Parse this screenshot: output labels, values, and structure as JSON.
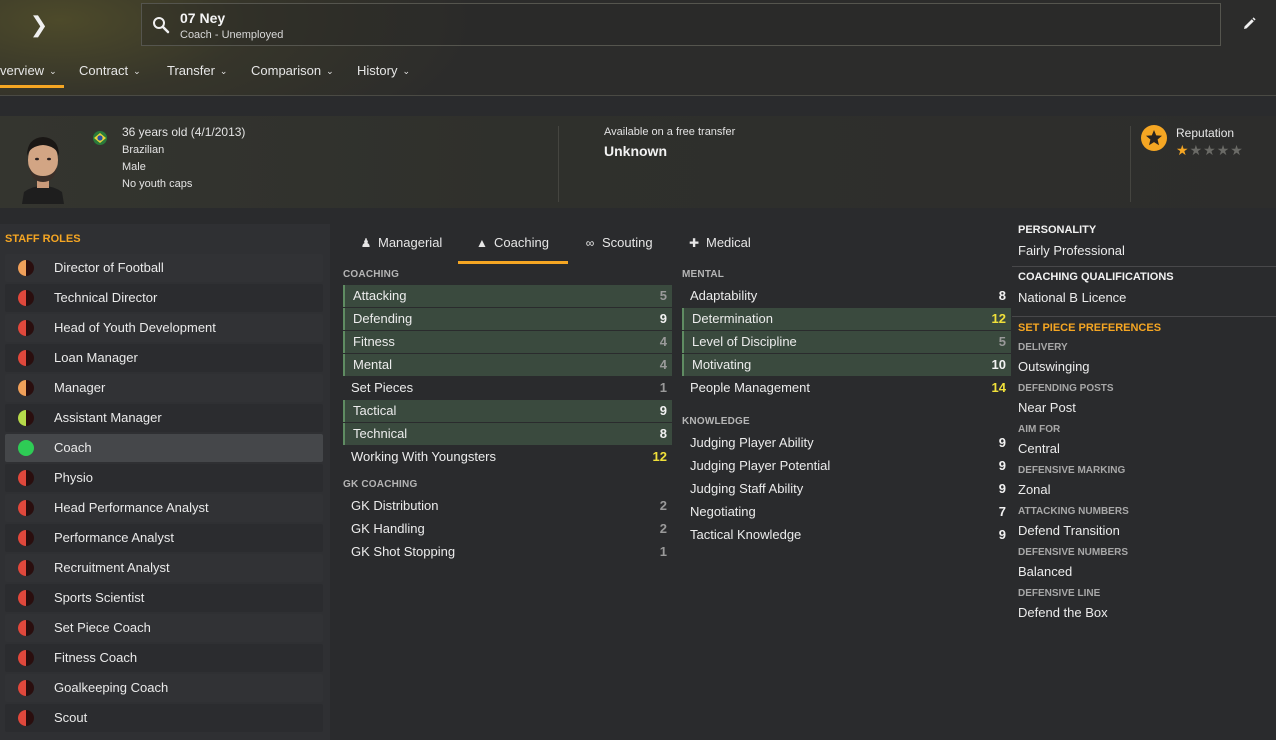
{
  "header": {
    "name": "07 Ney",
    "subtitle": "Coach - Unemployed"
  },
  "nav": [
    {
      "label": "verview",
      "active": true
    },
    {
      "label": "Contract"
    },
    {
      "label": "Transfer"
    },
    {
      "label": "Comparison"
    },
    {
      "label": "History"
    }
  ],
  "profile": {
    "age": "36 years old (4/1/2013)",
    "nationality": "Brazilian",
    "gender": "Male",
    "youth_caps": "No youth caps",
    "transfer_label": "Available on a free transfer",
    "transfer_value": "Unknown",
    "reputation_label": "Reputation",
    "reputation_stars": 1,
    "reputation_max": 5
  },
  "staff_roles": {
    "title": "STAFF ROLES",
    "items": [
      {
        "label": "Director of Football",
        "color": "#f0a05a"
      },
      {
        "label": "Technical Director",
        "color": "#e0483c"
      },
      {
        "label": "Head of Youth Development",
        "color": "#e0483c"
      },
      {
        "label": "Loan Manager",
        "color": "#e0483c"
      },
      {
        "label": "Manager",
        "color": "#f0a05a"
      },
      {
        "label": "Assistant Manager",
        "color": "#b6d94a"
      },
      {
        "label": "Coach",
        "color": "#2ecc55",
        "selected": true
      },
      {
        "label": "Physio",
        "color": "#e0483c"
      },
      {
        "label": "Head Performance Analyst",
        "color": "#e0483c"
      },
      {
        "label": "Performance Analyst",
        "color": "#e0483c"
      },
      {
        "label": "Recruitment Analyst",
        "color": "#e0483c"
      },
      {
        "label": "Sports Scientist",
        "color": "#e0483c"
      },
      {
        "label": "Set Piece Coach",
        "color": "#e0483c"
      },
      {
        "label": "Fitness Coach",
        "color": "#e0483c"
      },
      {
        "label": "Goalkeeping Coach",
        "color": "#e0483c"
      },
      {
        "label": "Scout",
        "color": "#e0483c"
      }
    ]
  },
  "tabs": [
    {
      "label": "Managerial",
      "icon": "managerial-icon"
    },
    {
      "label": "Coaching",
      "icon": "coaching-icon",
      "active": true
    },
    {
      "label": "Scouting",
      "icon": "binoculars-icon"
    },
    {
      "label": "Medical",
      "icon": "medical-kit-icon"
    }
  ],
  "coaching": {
    "title": "COACHING",
    "attrs": [
      {
        "name": "Attacking",
        "value": "5",
        "hl": true,
        "tone": "dim"
      },
      {
        "name": "Defending",
        "value": "9",
        "hl": true,
        "tone": "bright"
      },
      {
        "name": "Fitness",
        "value": "4",
        "hl": true,
        "tone": "dim"
      },
      {
        "name": "Mental",
        "value": "4",
        "hl": true,
        "tone": "dim"
      },
      {
        "name": "Set Pieces",
        "value": "1",
        "hl": false,
        "tone": "dim"
      },
      {
        "name": "Tactical",
        "value": "9",
        "hl": true,
        "tone": "bright"
      },
      {
        "name": "Technical",
        "value": "8",
        "hl": true,
        "tone": "bright"
      },
      {
        "name": "Working With Youngsters",
        "value": "12",
        "hl": false,
        "tone": "gold"
      }
    ]
  },
  "gk_coaching": {
    "title": "GK COACHING",
    "attrs": [
      {
        "name": "GK Distribution",
        "value": "2",
        "tone": "dim"
      },
      {
        "name": "GK Handling",
        "value": "2",
        "tone": "dim"
      },
      {
        "name": "GK Shot Stopping",
        "value": "1",
        "tone": "dim"
      }
    ]
  },
  "mental": {
    "title": "MENTAL",
    "attrs": [
      {
        "name": "Adaptability",
        "value": "8",
        "hl": false,
        "tone": "bright"
      },
      {
        "name": "Determination",
        "value": "12",
        "hl": true,
        "tone": "gold"
      },
      {
        "name": "Level of Discipline",
        "value": "5",
        "hl": true,
        "tone": "dim"
      },
      {
        "name": "Motivating",
        "value": "10",
        "hl": true,
        "tone": "bright"
      },
      {
        "name": "People Management",
        "value": "14",
        "hl": false,
        "tone": "gold"
      }
    ]
  },
  "knowledge": {
    "title": "KNOWLEDGE",
    "attrs": [
      {
        "name": "Judging Player Ability",
        "value": "9",
        "tone": "bright"
      },
      {
        "name": "Judging Player Potential",
        "value": "9",
        "tone": "bright"
      },
      {
        "name": "Judging Staff Ability",
        "value": "9",
        "tone": "bright"
      },
      {
        "name": "Negotiating",
        "value": "7",
        "tone": "bright"
      },
      {
        "name": "Tactical Knowledge",
        "value": "9",
        "tone": "bright"
      }
    ]
  },
  "details": {
    "personality_title": "PERSONALITY",
    "personality": "Fairly Professional",
    "quals_title": "COACHING QUALIFICATIONS",
    "quals": "National B Licence",
    "setpiece_title": "SET PIECE PREFERENCES",
    "prefs": [
      {
        "label": "DELIVERY",
        "value": "Outswinging"
      },
      {
        "label": "DEFENDING POSTS",
        "value": "Near Post"
      },
      {
        "label": "AIM FOR",
        "value": "Central"
      },
      {
        "label": "DEFENSIVE MARKING",
        "value": "Zonal"
      },
      {
        "label": "ATTACKING NUMBERS",
        "value": "Defend Transition"
      },
      {
        "label": "DEFENSIVE NUMBERS",
        "value": "Balanced"
      },
      {
        "label": "DEFENSIVE LINE",
        "value": "Defend the Box"
      }
    ]
  }
}
